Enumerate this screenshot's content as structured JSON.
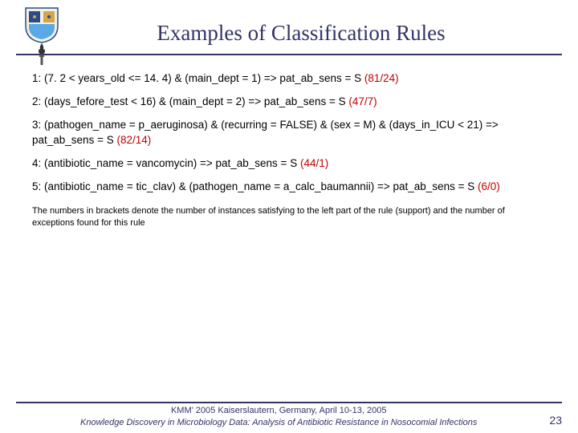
{
  "title": "Examples of Classification Rules",
  "rules": {
    "r1a": "1: (7. 2 < years_old <= 14. 4) & (main_dept = 1)  => pat_ab_sens = S ",
    "r1s": "(81/24)",
    "r2a": "2: (days_fefore_test < 16) & (main_dept = 2)  => pat_ab_sens = S ",
    "r2s": "(47/7)",
    "r3a": "3: (pathogen_name = p_aeruginosa) & (recurring = FALSE) & (sex = M) & (days_in_ICU < 21) => pat_ab_sens = S ",
    "r3s": "(82/14)",
    "r4a": "4: (antibiotic_name = vancomycin) => pat_ab_sens = S ",
    "r4s": "(44/1)",
    "r5a": "5: (antibiotic_name = tic_clav) & (pathogen_name = a_calc_baumannii) => pat_ab_sens = S ",
    "r5s": "(6/0)"
  },
  "note": "The numbers in brackets denote the number of instances satisfying to the left part of the rule (support) and the number of exceptions found for this rule",
  "footer": {
    "line1": "KMM' 2005 Kaiserslautern, Germany,  April 10-13, 2005",
    "line2": "Knowledge Discovery in Microbiology Data: Analysis of Antibiotic Resistance in Nosocomial Infections"
  },
  "page": "23"
}
